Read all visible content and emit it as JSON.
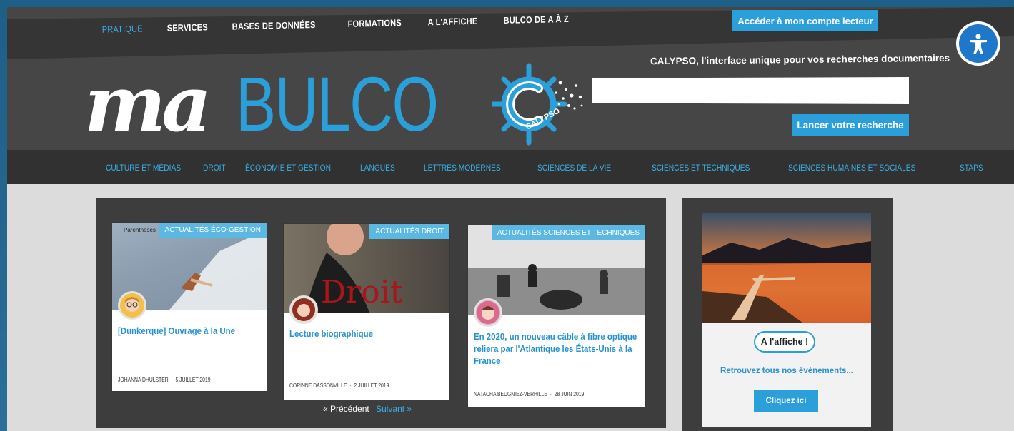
{
  "topnav": {
    "items": [
      {
        "label": "PRATIQUE",
        "active": true
      },
      {
        "label": "SERVICES"
      },
      {
        "label": "BASES DE DONNÉES"
      },
      {
        "label": "FORMATIONS"
      },
      {
        "label": "A L'AFFICHE"
      },
      {
        "label": "BULCO DE A À Z"
      }
    ],
    "account_button": "Accéder à mon compte lecteur",
    "accessibility_icon": "accessibility-icon"
  },
  "logo": {
    "part1": "ma",
    "part2": "BULCO"
  },
  "calypso": {
    "logo_text": "CALYPSO",
    "tagline": "CALYPSO, l'interface unique pour vos recherches documentaires",
    "search_placeholder": "",
    "search_button": "Lancer votre recherche"
  },
  "catnav": {
    "items": [
      "CULTURE ET MÉDIAS",
      "DROIT",
      "ÉCONOMIE ET GESTION",
      "LANGUES",
      "LETTRES MODERNES",
      "SCIENCES DE LA VIE",
      "SCIENCES ET TECHNIQUES",
      "SCIENCES HUMAINES ET SOCIALES",
      "STAPS"
    ]
  },
  "cards": [
    {
      "badge": "ACTUALITÉS ÉCO-GESTION",
      "image_caption": "Parenthèses",
      "title": "[Dunkerque] Ouvrage à la Une",
      "author": "JOHANNA DHULSTER",
      "date": "5 JUILLET 2019"
    },
    {
      "badge": "ACTUALITÉS DROIT",
      "image_text": "Droit",
      "title": "Lecture biographique",
      "author": "CORINNE DASSONVILLE",
      "date": "2 JUILLET 2019"
    },
    {
      "badge": "ACTUALITÉS SCIENCES ET TECHNIQUES",
      "title": "En 2020, un nouveau câble à fibre optique reliera par l'Atlantique les États-Unis à la France",
      "author": "NATACHA BEUGNIEZ-VERHILLE",
      "date": "28 JUIN 2019"
    }
  ],
  "meta_separator": "·",
  "pager": {
    "prev": "« Précédent",
    "next": "Suivant »"
  },
  "affiche": {
    "pill": "A l'affiche !",
    "text": "Retrouvez tous nos événements...",
    "button": "Cliquez ici"
  },
  "colors": {
    "accent": "#2b9fd9",
    "header": "#464646",
    "nav_dark": "#313131",
    "page_bg": "#dcdcdc"
  }
}
